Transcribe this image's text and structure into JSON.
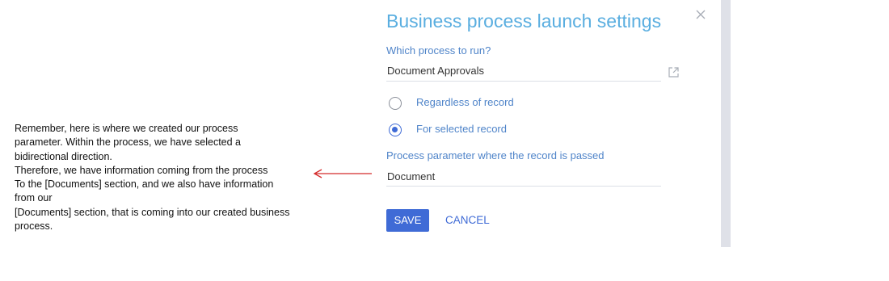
{
  "annotation": {
    "lines": [
      "Remember, here is where we created our process",
      "parameter. Within the process, we have selected a",
      "bidirectional direction.",
      "Therefore, we have information coming from the process",
      "To the [Documents] section, and we also have information",
      "from our",
      "[Documents] section, that is coming into our created business",
      "process."
    ],
    "arrow_color": "#d42a2a"
  },
  "dialog": {
    "title": "Business process launch settings",
    "close_icon": "close-icon",
    "process_label": "Which process to run?",
    "process_value": "Document Approvals",
    "open_icon": "open-in-new-icon",
    "options": [
      {
        "label": "Regardless of record",
        "checked": false
      },
      {
        "label": "For selected record",
        "checked": true
      }
    ],
    "parameter_label": "Process parameter where the record is passed",
    "parameter_value": "Document",
    "save_label": "SAVE",
    "cancel_label": "CANCEL"
  },
  "colors": {
    "title": "#5aaee0",
    "label": "#4f84c9",
    "accent": "#3f6bd6",
    "arrow": "#d42a2a"
  }
}
